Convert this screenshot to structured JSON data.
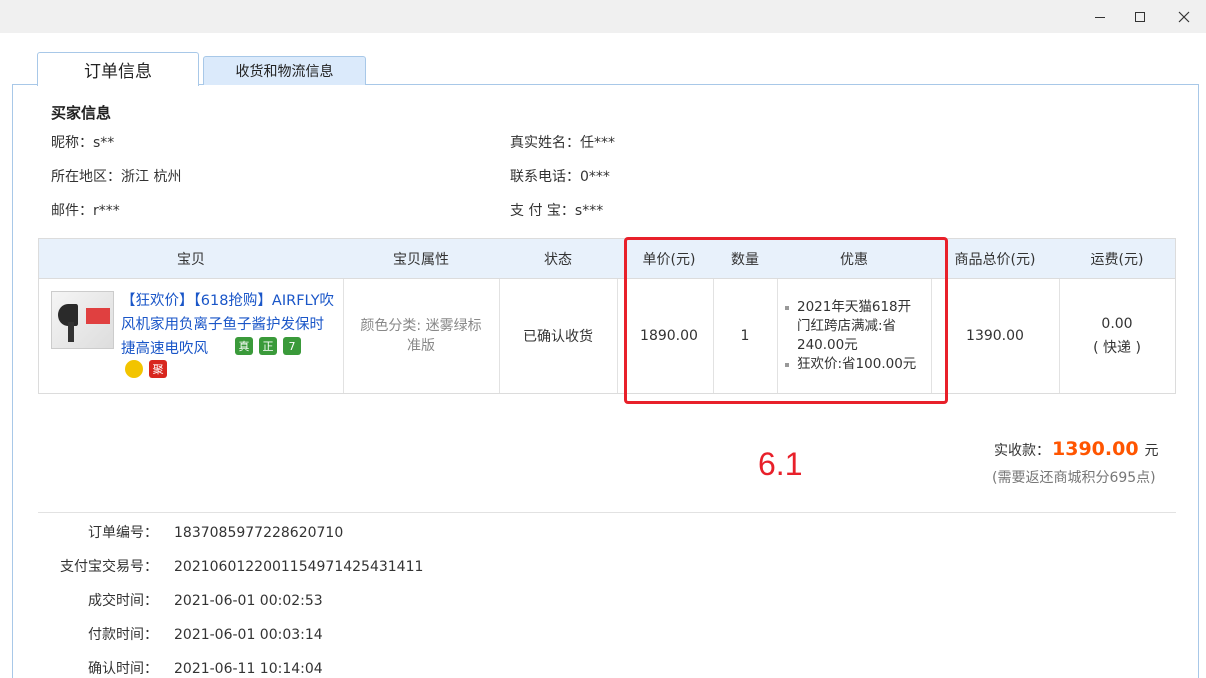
{
  "tabs": {
    "active": "订单信息",
    "inactive": "收货和物流信息"
  },
  "buyer": {
    "title": "买家信息",
    "nickname_label": "昵称：",
    "nickname": "s**",
    "realname_label": "真实姓名：",
    "realname": "任***",
    "region_label": "所在地区：",
    "region": "浙江 杭州",
    "phone_label": "联系电话：",
    "phone": "0***",
    "email_label": "邮件：",
    "email": "r***",
    "alipay_label": "支 付 宝：",
    "alipay": "s***"
  },
  "table": {
    "headers": [
      "宝贝",
      "宝贝属性",
      "状态",
      "单价(元)",
      "数量",
      "优惠",
      "商品总价(元)",
      "运费(元)"
    ],
    "row": {
      "title": "【狂欢价】【618抢购】AIRFLY吹风机家用负离子鱼子酱护发保时捷高速电吹风",
      "attribute": "颜色分类: 迷雾绿标准版",
      "status": "已确认收货",
      "unit_price": "1890.00",
      "quantity": "1",
      "promotions": [
        "2021年天猫618开门红跨店满减:省240.00元",
        "狂欢价:省100.00元"
      ],
      "total": "1390.00",
      "shipping": "0.00",
      "shipping_method": "( 快递 )",
      "badges": [
        "真",
        "正",
        "7",
        "",
        "聚"
      ]
    }
  },
  "payment": {
    "received_label": "实收款：",
    "received_amount": "1390.00",
    "currency": "元",
    "note": "(需要返还商城积分695点)"
  },
  "annotation": "6.1",
  "order_details": [
    {
      "label": "订单编号：",
      "value": "1837085977228620710"
    },
    {
      "label": "支付宝交易号：",
      "value": "2021060122001154971425431411"
    },
    {
      "label": "成交时间：",
      "value": "2021-06-01 00:02:53"
    },
    {
      "label": "付款时间：",
      "value": "2021-06-01 00:03:14"
    },
    {
      "label": "确认时间：",
      "value": "2021-06-11 10:14:04"
    }
  ],
  "colors": {
    "accent_red": "#e8202a",
    "price_orange": "#ff5500",
    "link_blue": "#1a56c8",
    "tab_border": "#a8c8e8"
  }
}
